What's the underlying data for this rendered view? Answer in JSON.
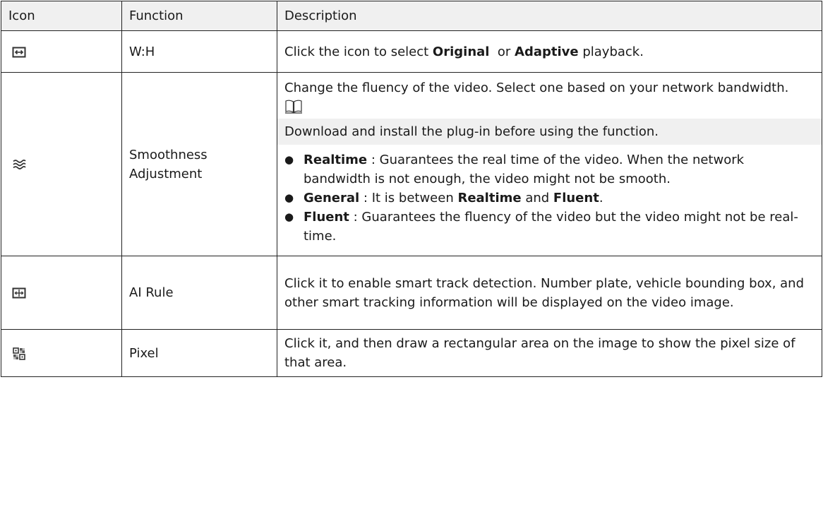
{
  "headers": {
    "icon": "Icon",
    "function": "Function",
    "description": "Description"
  },
  "rows": [
    {
      "icon": "aspect-ratio-icon",
      "function": "W:H",
      "desc_pre": "Click the icon to select ",
      "desc_b1": "Original",
      "desc_mid": "  or ",
      "desc_b2": "Adaptive",
      "desc_post": " playback."
    },
    {
      "icon": "smoothness-icon",
      "function_line1": "Smoothness",
      "function_line2": "Adjustment",
      "intro": "Change the fluency of the video. Select one based on your network bandwidth.",
      "note_icon": "book-icon",
      "note": "Download and install the plug-in before using the function.",
      "bullets": [
        {
          "term": "Realtime",
          "text": " : Guarantees the real time of the video. When the network bandwidth is not enough, the video might not be smooth."
        },
        {
          "term": "General",
          "text": " : It is between ",
          "b1": "Realtime",
          "and": " and ",
          "b2": "Fluent",
          "end": "."
        },
        {
          "term": "Fluent",
          "text": " : Guarantees the fluency of the video but the video might not be real-time."
        }
      ]
    },
    {
      "icon": "ai-rule-icon",
      "function": "AI Rule",
      "desc": "Click it to enable smart track detection. Number plate, vehicle bounding box, and other smart tracking information will be displayed on the video image."
    },
    {
      "icon": "pixel-icon",
      "function": "Pixel",
      "desc": "Click it, and then draw a rectangular area on the image to show the pixel size of that area."
    }
  ]
}
